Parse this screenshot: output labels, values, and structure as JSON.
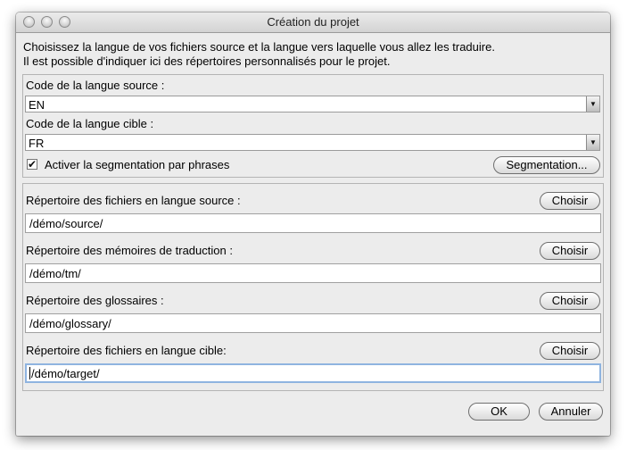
{
  "window": {
    "title": "Création du projet"
  },
  "intro": {
    "line1": "Choisissez la langue de vos fichiers source et la langue vers laquelle vous allez les traduire.",
    "line2": "Il est possible d'indiquer ici des répertoires personnalisés pour le projet."
  },
  "languages": {
    "source_label": "Code de la langue source :",
    "source_value": "EN",
    "target_label": "Code de la langue cible :",
    "target_value": "FR",
    "segmentation_checkbox_label": "Activer la segmentation par phrases",
    "segmentation_checked": true,
    "segmentation_button": "Segmentation..."
  },
  "directories": [
    {
      "label": "Répertoire des fichiers en langue source :",
      "value": "/démo/source/",
      "button": "Choisir"
    },
    {
      "label": "Répertoire des mémoires de traduction :",
      "value": "/démo/tm/",
      "button": "Choisir"
    },
    {
      "label": "Répertoire des glossaires :",
      "value": "/démo/glossary/",
      "button": "Choisir"
    },
    {
      "label": "Répertoire des fichiers en langue cible:",
      "value": "/démo/target/",
      "button": "Choisir"
    }
  ],
  "footer": {
    "ok": "OK",
    "cancel": "Annuler"
  }
}
